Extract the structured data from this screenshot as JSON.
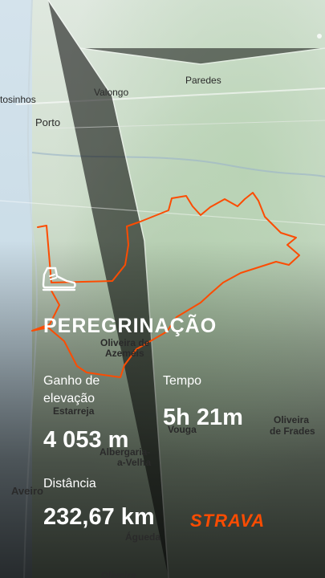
{
  "map": {
    "places": [
      {
        "key": "tosinhos",
        "label": "tosinhos"
      },
      {
        "key": "valongo",
        "label": "Valongo"
      },
      {
        "key": "paredes",
        "label": "Paredes"
      },
      {
        "key": "porto",
        "label": "Porto"
      },
      {
        "key": "oliveira_azemeis_1",
        "label": "Oliveira de"
      },
      {
        "key": "oliveira_azemeis_2",
        "label": "Azeméis"
      },
      {
        "key": "estarreja",
        "label": "Estarreja"
      },
      {
        "key": "vouga",
        "label": "Vouga"
      },
      {
        "key": "oliveira_frades_1",
        "label": "Oliveira"
      },
      {
        "key": "oliveira_frades_2",
        "label": "de Frades"
      },
      {
        "key": "albergaria_1",
        "label": "Albergaria-"
      },
      {
        "key": "albergaria_2",
        "label": "a-Velha"
      },
      {
        "key": "aveiro",
        "label": "Aveiro"
      },
      {
        "key": "agueda",
        "label": "Águeda"
      },
      {
        "key": "oliveira_bottom",
        "label": "Oliveira"
      }
    ],
    "route_color": "#fc4c02"
  },
  "activity": {
    "icon": "hiking-boot-icon",
    "title": "PEREGRINAÇÃO",
    "elevation_label": "Ganho de elevação",
    "elevation_value": "4 053 m",
    "time_label": "Tempo",
    "time_value": "5h 21m",
    "distance_label": "Distância",
    "distance_value": "232,67 km"
  },
  "brand": {
    "name": "STRAVA",
    "color": "#fc4c02"
  }
}
